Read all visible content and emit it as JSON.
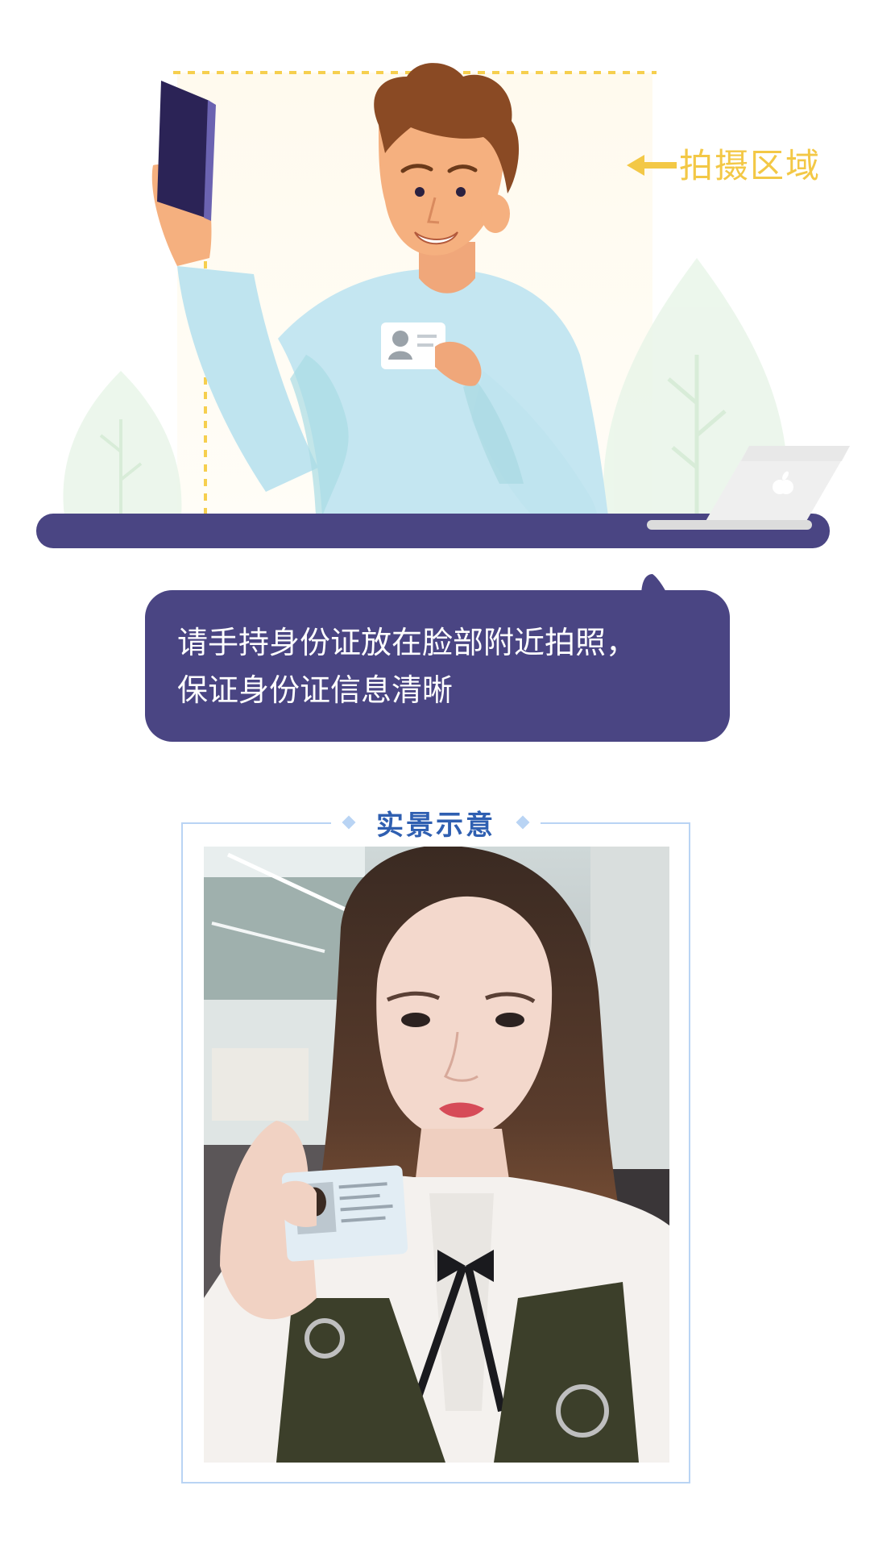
{
  "illustration": {
    "shooting_area_label": "拍摄区域"
  },
  "instruction": {
    "line1": "请手持身份证放在脸部附近拍照，",
    "line2": "保证身份证信息清晰"
  },
  "example": {
    "title": "实景示意"
  },
  "colors": {
    "dashed_outline": "#f6cf4e",
    "desk": "#4a4583",
    "bubble": "#4a4583",
    "frame_border": "#b9d4f4",
    "frame_title": "#2f5fb1",
    "label_yellow": "#f3c846"
  }
}
